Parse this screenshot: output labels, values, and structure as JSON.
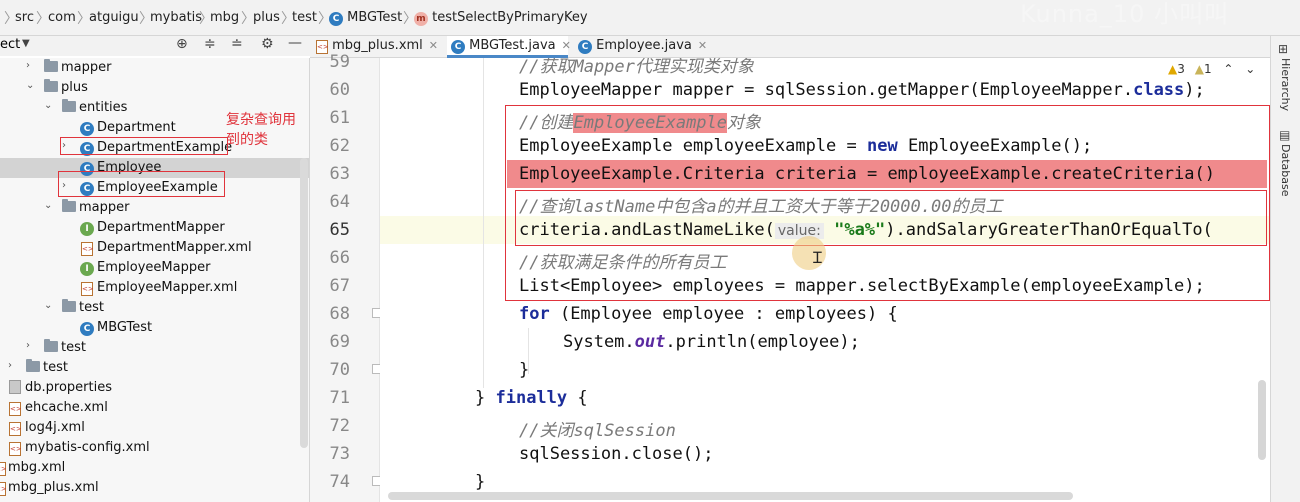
{
  "breadcrumb": {
    "items": [
      "src",
      "com",
      "atguigu",
      "mybatis",
      "mbg",
      "plus",
      "test",
      "MBGTest",
      "testSelectByPrimaryKey"
    ],
    "watermark": "Kunna_10 小叫叫"
  },
  "project_panel": {
    "title": "ect"
  },
  "tabs": [
    {
      "label": "mbg_plus.xml"
    },
    {
      "label": "MBGTest.java"
    },
    {
      "label": "Employee.java"
    }
  ],
  "inspection": {
    "warnings": "3",
    "weak_warnings": "1"
  },
  "tree": {
    "annotation": "复杂查询用到的类",
    "items": [
      {
        "label": "mapper",
        "type": "folder"
      },
      {
        "label": "plus",
        "type": "folder"
      },
      {
        "label": "entities",
        "type": "folder"
      },
      {
        "label": "Department",
        "type": "class"
      },
      {
        "label": "DepartmentExample",
        "type": "class"
      },
      {
        "label": "Employee",
        "type": "class"
      },
      {
        "label": "EmployeeExample",
        "type": "class"
      },
      {
        "label": "mapper",
        "type": "folder"
      },
      {
        "label": "DepartmentMapper",
        "type": "interface"
      },
      {
        "label": "DepartmentMapper.xml",
        "type": "xml"
      },
      {
        "label": "EmployeeMapper",
        "type": "interface"
      },
      {
        "label": "EmployeeMapper.xml",
        "type": "xml"
      },
      {
        "label": "test",
        "type": "folder"
      },
      {
        "label": "MBGTest",
        "type": "class"
      },
      {
        "label": "test",
        "type": "folder"
      },
      {
        "label": "test",
        "type": "folder"
      },
      {
        "label": "db.properties",
        "type": "props"
      },
      {
        "label": "ehcache.xml",
        "type": "xml"
      },
      {
        "label": "log4j.xml",
        "type": "xml"
      },
      {
        "label": "mybatis-config.xml",
        "type": "xml"
      },
      {
        "label": "mbg.xml",
        "type": "xml"
      },
      {
        "label": "mbg_plus.xml",
        "type": "xml"
      }
    ]
  },
  "line_numbers": [
    "59",
    "60",
    "61",
    "62",
    "63",
    "64",
    "65",
    "66",
    "67",
    "68",
    "69",
    "70",
    "71",
    "72",
    "73",
    "74"
  ],
  "code": {
    "l59": "//获取Mapper代理实现类对象",
    "l60a": "EmployeeMapper mapper = sqlSession.getMapper(EmployeeMapper.",
    "l60b": "class",
    "l60c": ");",
    "l61a": "//创建",
    "l61b": "EmployeeExample",
    "l61c": "对象",
    "l62a": "EmployeeExample employeeExample = ",
    "l62b": "new",
    "l62c": " EmployeeExample();",
    "l63": "EmployeeExample.Criteria criteria = employeeExample.createCriteria()",
    "l64": "//查询lastName中包含a的并且工资大于等于20000.00的员工",
    "l65a": "criteria.andLastNameLike(",
    "l65hint": "value:",
    "l65b": "\"%a%\"",
    "l65c": ").andSalaryGreaterThanOrEqualTo(",
    "l66": "//获取满足条件的所有员工",
    "l67": "List<Employee> employees = mapper.selectByExample(employeeExample);",
    "l68a": "for",
    "l68b": " (Employee employee : employees) {",
    "l69a": "System.",
    "l69b": "out",
    "l69c": ".println(employee);",
    "l70": "}",
    "l71a": "} ",
    "l71b": "finally",
    "l71c": " {",
    "l72": "//关闭sqlSession",
    "l73": "sqlSession.close();",
    "l74": "}"
  },
  "side_tabs": [
    "Hierarchy",
    "Database"
  ],
  "colors": {
    "annotation_red": "#e0343c",
    "highlight_pink": "#f08a8c",
    "active_tab_blue": "#4a88c7"
  }
}
